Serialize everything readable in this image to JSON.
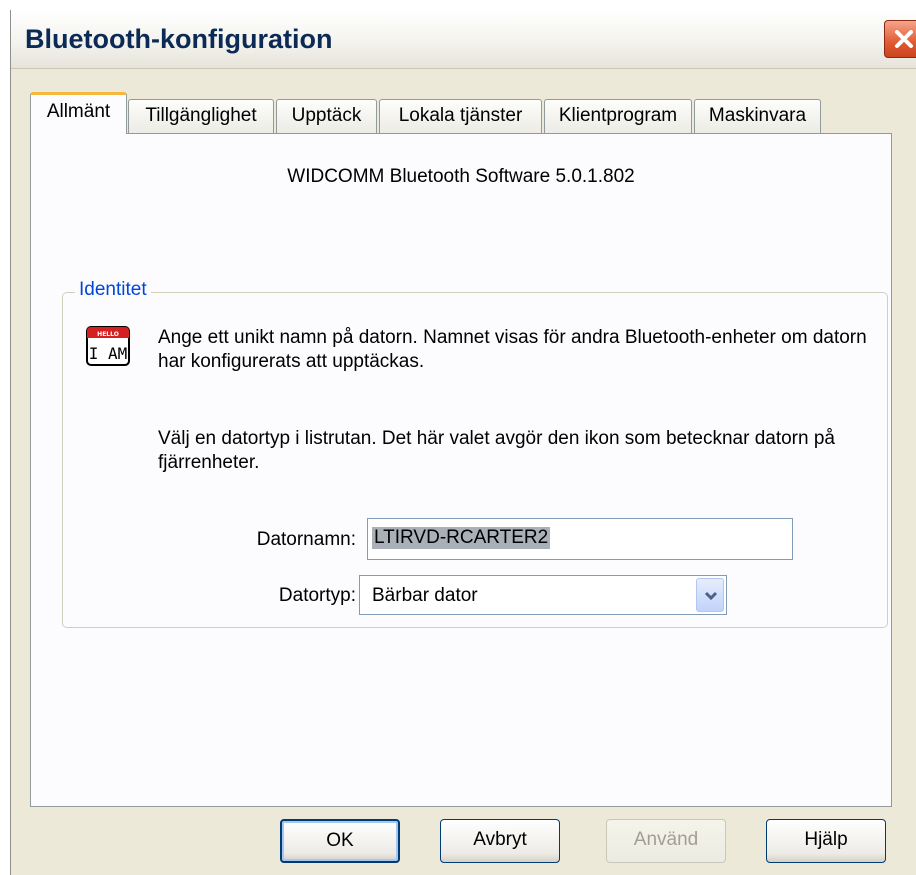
{
  "window": {
    "title": "Bluetooth-konfiguration"
  },
  "tabs": [
    {
      "label": "Allmänt",
      "active": true
    },
    {
      "label": "Tillgänglighet",
      "active": false
    },
    {
      "label": "Upptäck",
      "active": false
    },
    {
      "label": "Lokala tjänster",
      "active": false
    },
    {
      "label": "Klientprogram",
      "active": false
    },
    {
      "label": "Maskinvara",
      "active": false
    }
  ],
  "general": {
    "version": "WIDCOMM Bluetooth Software 5.0.1.802",
    "identity": {
      "legend": "Identitet",
      "icon_hello": "HELLO",
      "icon_iam": "I AM",
      "description1": "Ange ett unikt namn på datorn. Namnet visas för andra Bluetooth-enheter om datorn har konfigurerats att upptäckas.",
      "description2": "Välj en datortyp i listrutan. Det här valet avgör den ikon som betecknar datorn på fjärrenheter.",
      "computer_name_label": "Datornamn:",
      "computer_name_value": "LTIRVD-RCARTER2",
      "computer_type_label": "Datortyp:",
      "computer_type_value": "Bärbar dator"
    }
  },
  "buttons": {
    "ok": "OK",
    "cancel": "Avbryt",
    "apply": "Använd",
    "help": "Hjälp"
  },
  "colors": {
    "title_text": "#0b2a55",
    "group_legend": "#0046d5",
    "active_tab_accent": "#f5b83d",
    "close_button": "#e05a32"
  },
  "icons": {
    "close": "close-icon",
    "identity": "hello-i-am-icon",
    "dropdown": "chevron-down-icon"
  }
}
